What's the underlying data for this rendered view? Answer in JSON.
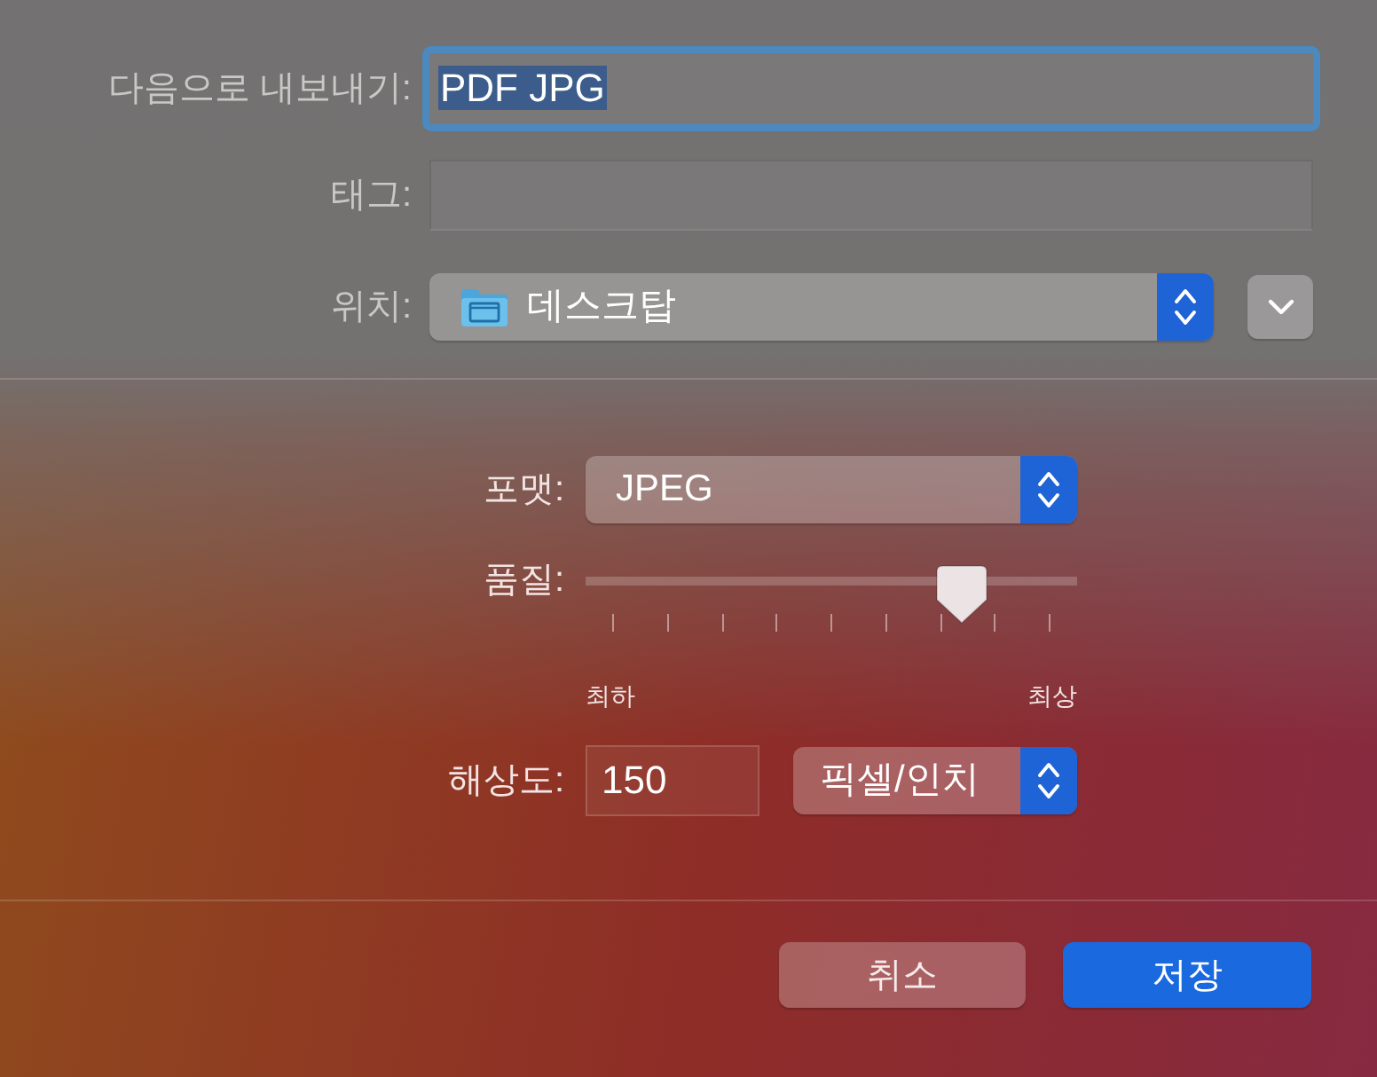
{
  "export_as": {
    "label": "다음으로 내보내기:",
    "value": "PDF JPG",
    "focused": true,
    "text_selected": true
  },
  "tags": {
    "label": "태그:"
  },
  "location": {
    "label": "위치:",
    "value": "데스크탑",
    "expanded": false
  },
  "format": {
    "label": "포맷:",
    "value": "JPEG"
  },
  "quality": {
    "label": "품질:",
    "level": 0.8,
    "min_label": "최하",
    "max_label": "최상"
  },
  "resolution": {
    "label": "해상도:",
    "value": "150",
    "unit": "픽셀/인치"
  },
  "buttons": [
    {
      "label": "취소",
      "kind": "cancel"
    },
    {
      "label": "저장",
      "kind": "default"
    }
  ]
}
